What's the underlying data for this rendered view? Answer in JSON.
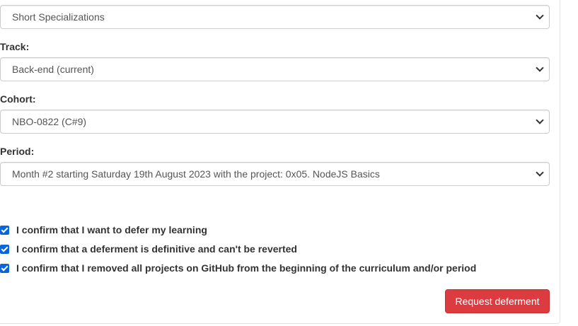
{
  "form": {
    "specialization": {
      "value": "Short Specializations"
    },
    "track": {
      "label": "Track:",
      "value": "Back-end (current)"
    },
    "cohort": {
      "label": "Cohort:",
      "value": "NBO-0822 (C#9)"
    },
    "period": {
      "label": "Period:",
      "value": "Month #2 starting Saturday 19th August 2023 with the project: 0x05. NodeJS Basics"
    },
    "confirmations": [
      {
        "label": "I confirm that I want to defer my learning",
        "checked": true
      },
      {
        "label": "I confirm that a deferment is definitive and can't be reverted",
        "checked": true
      },
      {
        "label": "I confirm that I removed all projects on GitHub from the beginning of the curriculum and/or period",
        "checked": true
      }
    ],
    "submit_label": "Request deferment"
  },
  "colors": {
    "checkbox": "#0a66d8",
    "button": "#dc3c3f"
  }
}
